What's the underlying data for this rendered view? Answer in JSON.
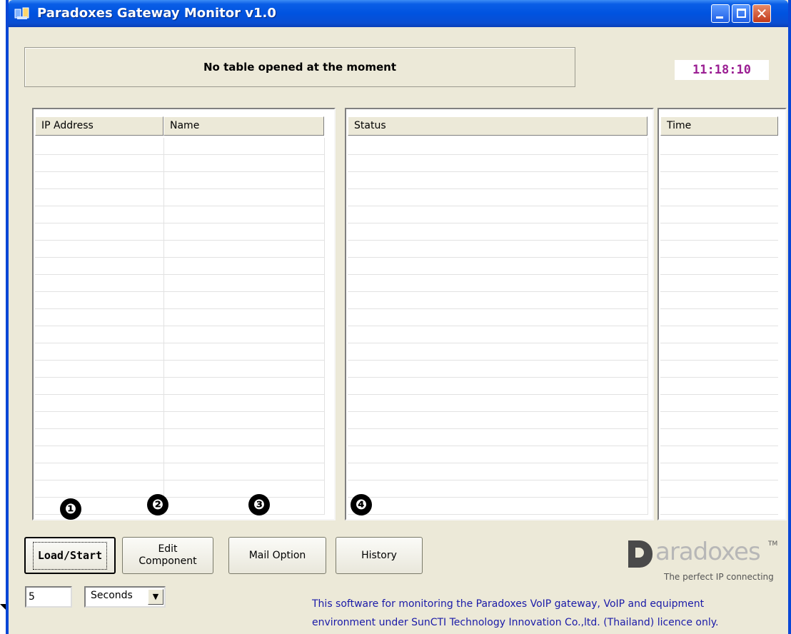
{
  "window": {
    "title": "Paradoxes Gateway Monitor v1.0",
    "controls": [
      "minimize-icon",
      "maximize-icon",
      "close-icon"
    ]
  },
  "banner": {
    "message": "No table opened at the moment"
  },
  "clock": {
    "time": "11:18:10"
  },
  "table": {
    "columns": [
      "IP Address",
      "Name",
      "Status",
      "Time"
    ]
  },
  "markers": [
    "❶",
    "❷",
    "❸",
    "❹"
  ],
  "buttons": {
    "load_start": "Load/Start",
    "edit_component_line1": "Edit",
    "edit_component_line2": "Component",
    "mail_option": "Mail Option",
    "history": "History"
  },
  "interval": {
    "value": "5",
    "unit": "Seconds"
  },
  "logo": {
    "word": "aradoxes",
    "tm": "TM",
    "tagline": "The perfect IP connecting"
  },
  "footer": {
    "line1": "This software for monitoring the Paradoxes VoIP gateway, VoIP  and equipment",
    "line2": "environment under SunCTI Technology Innovation Co.,ltd. (Thailand) licence only."
  },
  "colors": {
    "titlebar": "#0053e0",
    "clock_text": "#9b1f93",
    "footer_text": "#1a1aa8"
  }
}
